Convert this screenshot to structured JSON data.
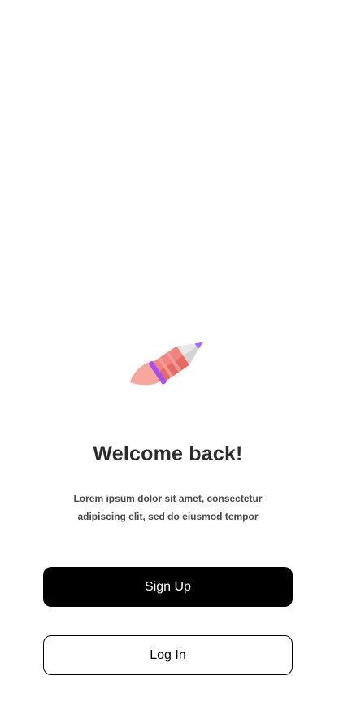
{
  "illustration": {
    "icon": "rocket-icon",
    "colors": {
      "body": "#f2837d",
      "body_shade": "#e46a67",
      "nose": "#e8e8e8",
      "tip": "#a66cf0",
      "band": "#a54ff0",
      "flame": "#f9a79c"
    }
  },
  "welcome": {
    "title": "Welcome back!",
    "subtitle_line1": "Lorem ipsum dolor sit amet, consectetur",
    "subtitle_line2": "adipiscing elit, sed do eiusmod tempor"
  },
  "actions": {
    "signup_label": "Sign Up",
    "login_label": "Log In"
  },
  "colors": {
    "primary": "#000000",
    "text": "#2b2b2b",
    "muted": "#4a4a4a",
    "background": "#ffffff"
  }
}
